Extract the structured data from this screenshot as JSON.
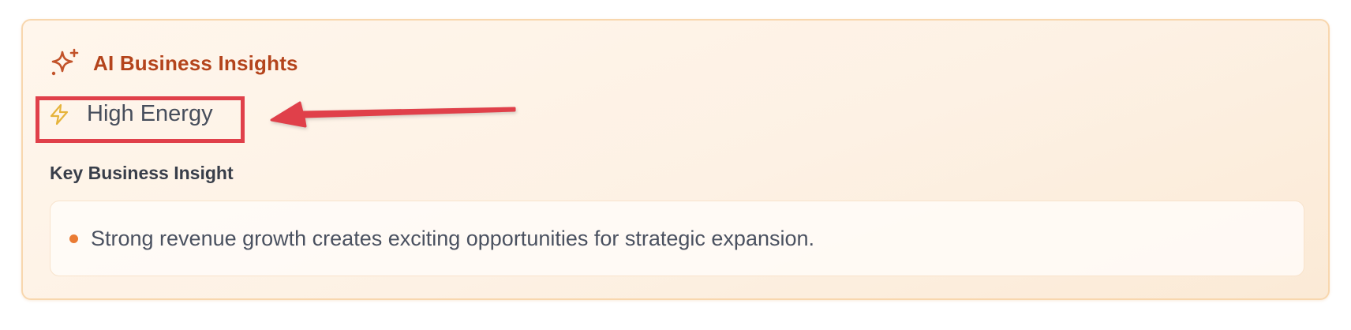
{
  "card": {
    "title": "AI Business Insights",
    "title_icon": "sparkles-icon",
    "energy_badge": {
      "icon": "lightning-bolt-icon",
      "label": "High Energy"
    },
    "section_label": "Key Business Insight",
    "insights": [
      "Strong revenue growth creates exciting opportunities for strategic expansion."
    ]
  },
  "annotation": {
    "type": "highlight-box-with-arrow"
  },
  "colors": {
    "title": "#b4441c",
    "card_border": "#f8d7ae",
    "card_background": "#fdf1e4",
    "bolt": "#e6b43c",
    "bullet": "#ea7b33",
    "annotation_red": "#e0404a"
  }
}
